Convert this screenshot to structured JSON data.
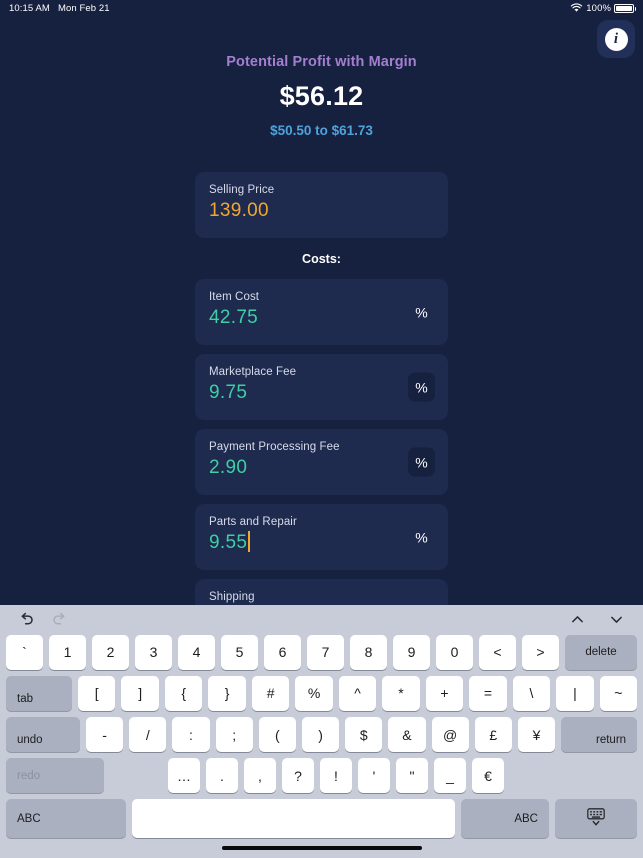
{
  "status_bar": {
    "time": "10:15 AM",
    "date": "Mon Feb 21",
    "battery_percent": "100%",
    "wifi_icon": "wifi-icon",
    "battery_icon": "battery-icon"
  },
  "app": {
    "info_button": {
      "icon": "info-icon",
      "glyph": "i"
    },
    "headline": {
      "title": "Potential Profit with Margin",
      "amount": "$56.12",
      "range": "$50.50 to $61.73"
    },
    "selling_price": {
      "label": "Selling Price",
      "value": "139.00"
    },
    "costs_heading": "Costs:",
    "cost_fields": [
      {
        "label": "Item Cost",
        "value": "42.75",
        "percent_symbol": "%",
        "percent_selected": false,
        "focused": false
      },
      {
        "label": "Marketplace Fee",
        "value": "9.75",
        "percent_symbol": "%",
        "percent_selected": true,
        "focused": false
      },
      {
        "label": "Payment Processing Fee",
        "value": "2.90",
        "percent_symbol": "%",
        "percent_selected": true,
        "focused": false
      },
      {
        "label": "Parts and Repair",
        "value": "9.55",
        "percent_symbol": "%",
        "percent_selected": false,
        "focused": true
      },
      {
        "label": "Shipping",
        "value": "",
        "percent_symbol": "%",
        "percent_selected": false,
        "focused": false
      }
    ]
  },
  "keyboard": {
    "toolbar": {
      "undo_icon": "undo-icon",
      "redo_icon": "redo-icon",
      "prev_icon": "chevron-up-icon",
      "next_icon": "chevron-down-icon"
    },
    "row1": [
      "`",
      "1",
      "2",
      "3",
      "4",
      "5",
      "6",
      "7",
      "8",
      "9",
      "0",
      "<",
      ">"
    ],
    "row1_delete": "delete",
    "row2_tab": "tab",
    "row2": [
      "[",
      "]",
      "{",
      "}",
      "#",
      "%",
      "^",
      "*",
      "+",
      "=",
      "\\",
      "|",
      "~"
    ],
    "row3_undo": "undo",
    "row3": [
      "-",
      "/",
      ":",
      ";",
      "(",
      ")",
      "$",
      "&",
      "@",
      "£",
      "¥"
    ],
    "row3_return": "return",
    "row4_redo": "redo",
    "row4": [
      "…",
      ".",
      ",",
      "?",
      "!",
      "'",
      "\"",
      "_",
      "€"
    ],
    "bottom": {
      "abc_left": "ABC",
      "space": "",
      "abc_right": "ABC",
      "dismiss_icon": "keyboard-dismiss-icon"
    }
  },
  "colors": {
    "page_bg": "#16203f",
    "card_bg": "#1e2a4e",
    "accent_purple": "#a47fd0",
    "accent_blue": "#4ea3dd",
    "accent_amber": "#f0a92e",
    "accent_teal": "#3ecfa4",
    "keyboard_bg": "#c8ccd8"
  }
}
